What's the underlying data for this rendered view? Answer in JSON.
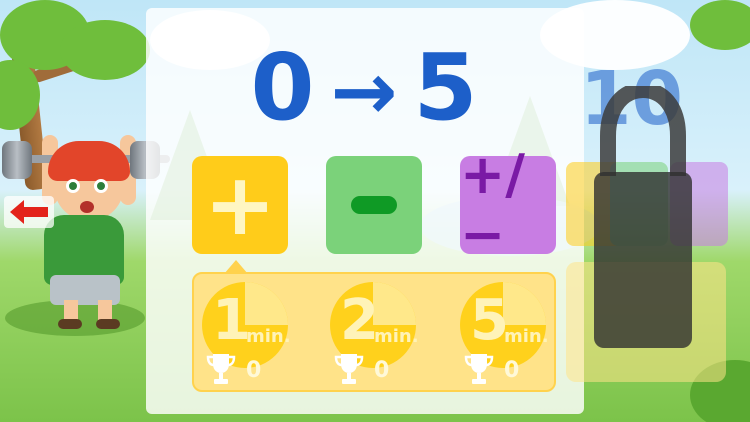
{
  "range": {
    "from": "0",
    "arrow": "→",
    "to": "5"
  },
  "operations": [
    {
      "name": "addition",
      "symbol": "+"
    },
    {
      "name": "subtraction",
      "symbol": "−"
    },
    {
      "name": "mixed",
      "symbol": "+/−"
    }
  ],
  "timers": [
    {
      "minutes": "1",
      "unit": "min.",
      "trophies": "0"
    },
    {
      "minutes": "2",
      "unit": "min.",
      "trophies": "0"
    },
    {
      "minutes": "5",
      "unit": "min.",
      "trophies": "0"
    }
  ],
  "locked_level": {
    "title": "10",
    "locked": true
  },
  "colors": {
    "title_blue": "#1d5fc9",
    "plus_yellow": "#ffcc1a",
    "minus_green": "#7bd27a",
    "mixed_purple": "#c87de3",
    "back_arrow_red": "#e3231b"
  },
  "icons": {
    "back": "back-arrow-icon",
    "trophy": "trophy-icon",
    "lock": "padlock-icon"
  }
}
